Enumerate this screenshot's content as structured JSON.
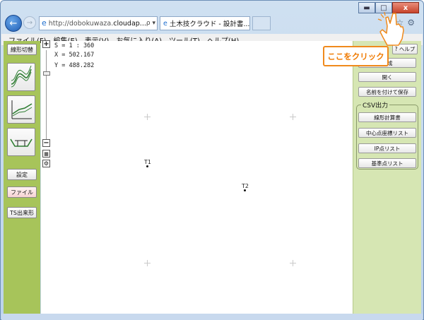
{
  "window": {
    "controls": {
      "minimize": "▬",
      "maximize": "□",
      "close": "x"
    }
  },
  "navigation": {
    "back_icon": "arrow-left-icon",
    "forward_icon": "arrow-right-icon",
    "address_prefix": "http://",
    "address_domain": "dobokuwaza.",
    "address_host": "cloudap...",
    "address_tools": "ρ ▾ C",
    "tab_title": "土木技クラウド - 設計書...",
    "tab_close": "×",
    "toolbar_icons": [
      "home-icon",
      "star-icon",
      "gear-icon"
    ]
  },
  "menu": {
    "items": [
      "ファイル(F)",
      "編集(E)",
      "表示(V)",
      "お気に入り(A)",
      "ツール(T)",
      "ヘルプ(H)"
    ]
  },
  "left_toolbar": {
    "mode_button": "線形切替",
    "icons": [
      "plan-view-icon",
      "profile-view-icon",
      "cross-section-icon"
    ],
    "settings_button": "設定",
    "file_button": "ファイル",
    "ts_button": "TS出来形"
  },
  "zoom": {
    "plus": "+",
    "minus": "−",
    "fit_icon": "fit-icon",
    "settings_icon": "gear-icon"
  },
  "readout": {
    "scale": "S = 1 : 360",
    "x": "X = 502.167",
    "y": "Y = 488.282"
  },
  "canvas": {
    "points": [
      "T1",
      "T2"
    ]
  },
  "right_panel": {
    "help_label": "? ヘルプ",
    "create_label": "作成",
    "open_label": "開く",
    "save_as_label": "名前を付けて保存",
    "csv_group_label": "CSV出力",
    "csv_buttons": [
      "線形計算書",
      "中心点座標リスト",
      "IP点リスト",
      "基準点リスト"
    ]
  },
  "callout": {
    "text": "ここをクリック"
  },
  "colors": {
    "left_toolbar_bg": "#a7c45a",
    "right_panel_bg": "#d6e6b3",
    "callout_border": "#f08a1c",
    "callout_text": "#ef7a00",
    "close_button": "#c7442b"
  }
}
